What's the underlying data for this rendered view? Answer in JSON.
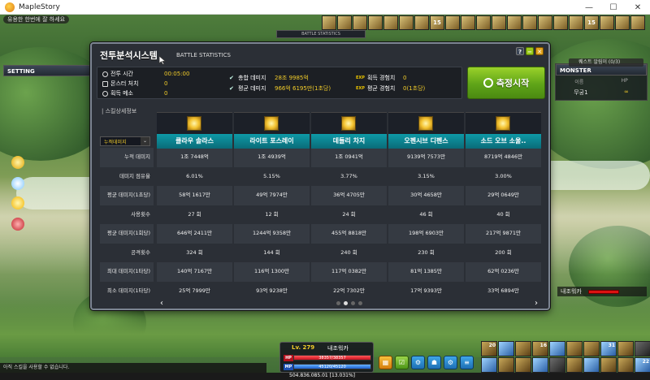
{
  "window": {
    "title": "MapleStory",
    "minimize": "—",
    "maximize": "☐",
    "close": "✕"
  },
  "notice": "유용한 한번에 잘 하세요",
  "setting": {
    "label": "SETTING"
  },
  "monster": {
    "label": "MONSTER",
    "name_header": "이름",
    "hp_header": "HP",
    "name": "무궁1",
    "hp": "∞"
  },
  "quest_label": "퀘스트 알림이 (0/3)",
  "party": {
    "name": "내조워카"
  },
  "buffs": [
    "",
    "",
    "",
    "",
    "",
    "",
    "",
    "15",
    "",
    "",
    "",
    "",
    "",
    "",
    "",
    "",
    "",
    "15",
    "",
    "",
    ""
  ],
  "dialog": {
    "title": "전투분석시스템",
    "subtitle": "BATTLE STATISTICS",
    "tab_label": "BATTLE STATISTICS",
    "help": "?",
    "minimize": "−",
    "close": "✕",
    "summary": {
      "battle_time_label": "전투 시간",
      "battle_time": "00:05:00",
      "monster_kill_label": "몬스터 처치",
      "monster_kill": "0",
      "acquire_label": "획득 메소",
      "acquire": "0",
      "total_dmg_label": "총합 데미지",
      "total_dmg": "28조 9985억",
      "avg_dmg_label": "평균 데미지",
      "avg_dmg": "966억 6195만(1초당)",
      "exp_label": "획득 경험치",
      "exp": "0",
      "avg_exp_label": "평균 경험치",
      "avg_exp": "0(1초당)",
      "exp_tag": "EXP"
    },
    "measure_button": "측정시작",
    "detail_label": "| 스킬상세정보",
    "filter_value": "누적데미지",
    "filter_arrow": "⌄",
    "row_labels": [
      "누적 데미지",
      "데미지 점유율",
      "평균 데미지(1초당)",
      "사용횟수",
      "평균 데미지(1회당)",
      "공격횟수",
      "최대 데미지(1타당)",
      "최소 데미지(1타당)"
    ],
    "skills": [
      {
        "name": "클라우 솔라스",
        "values": [
          "1조 7448억",
          "6.01%",
          "58억 1617만",
          "27 회",
          "646억 2411만",
          "324 회",
          "140억 7167만",
          "25억 7999만"
        ]
      },
      {
        "name": "라이트 포스레이",
        "values": [
          "1조 4939억",
          "5.15%",
          "49억 7974만",
          "12 회",
          "1244억 9358만",
          "144 회",
          "116억 1300만",
          "93억 9238만"
        ]
      },
      {
        "name": "데들리 차지",
        "values": [
          "1조 0941억",
          "3.77%",
          "36억 4705만",
          "24 회",
          "455억 8818만",
          "240 회",
          "117억 0382만",
          "22억 7302만"
        ]
      },
      {
        "name": "오펜시브 디펜스",
        "values": [
          "9139억 7573만",
          "3.15%",
          "30억 4658만",
          "46 회",
          "198억 6903만",
          "230 회",
          "81억 1385만",
          "17억 9393만"
        ]
      },
      {
        "name": "소드 오브 소울..",
        "values": [
          "8719억 4846만",
          "3.00%",
          "29억 0649만",
          "40 회",
          "217억 9871만",
          "200 회",
          "62억 0236만",
          "33억 6894만"
        ]
      }
    ],
    "pager": {
      "prev": "‹",
      "next": "›",
      "pages": 4,
      "current": 1
    }
  },
  "hud": {
    "chat": "아직 스킬을 사용할 수 없습니다.",
    "level": "Lv. 279",
    "name": "내조워카",
    "hp_tag": "HP",
    "mp_tag": "MP",
    "hp": "38357/38357",
    "mp": "45120/45120",
    "exp_text": "504.836.085.01 [13.031%]",
    "buttons": [
      "▦",
      "☑",
      "⚙",
      "☗",
      "⚙",
      "≡"
    ]
  },
  "quickslots": [
    "20",
    "",
    "",
    "16",
    "",
    "",
    "",
    "31",
    "",
    "",
    "",
    "",
    "",
    "",
    "",
    "",
    "",
    "",
    "",
    "22"
  ],
  "colors": {
    "accent_gold": "#f2cc2a",
    "measure_green": "#5fa418",
    "skill_head": "#0e9aa7"
  }
}
